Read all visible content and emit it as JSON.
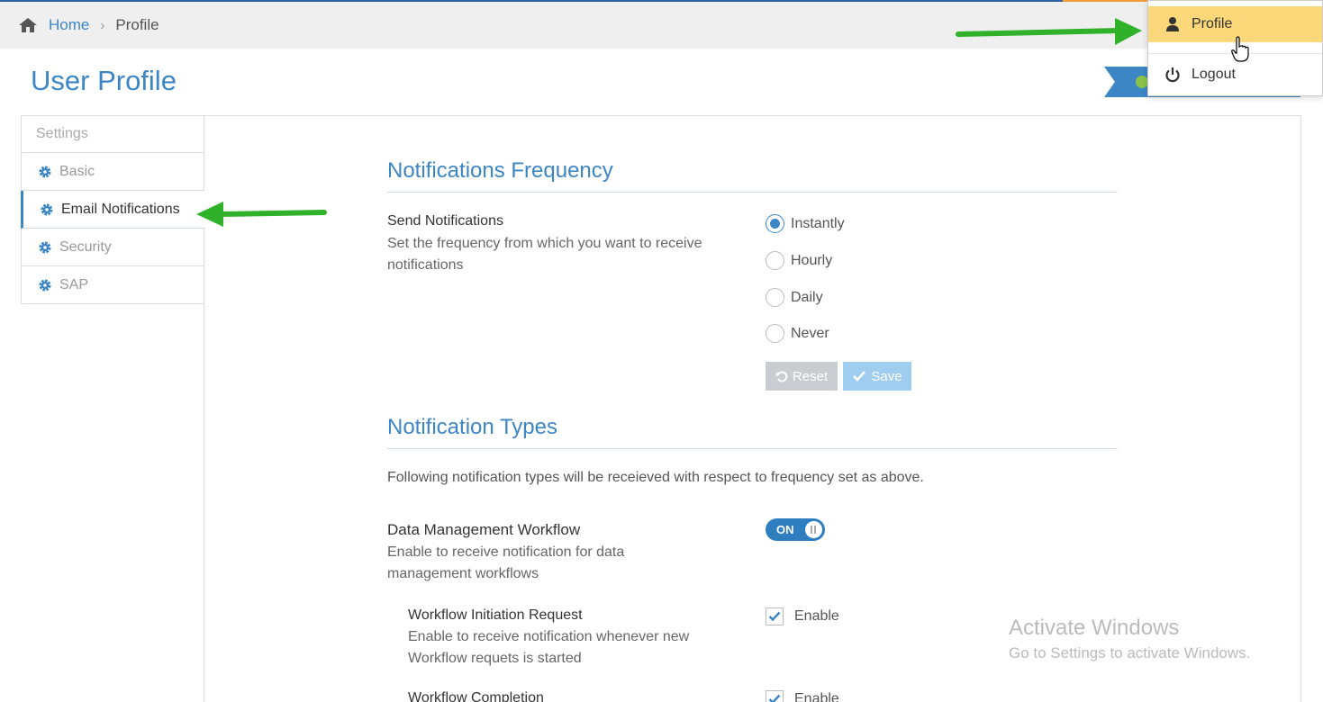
{
  "breadcrumb": {
    "home": "Home",
    "current": "Profile"
  },
  "page": {
    "title": "User Profile"
  },
  "sidebar": {
    "header": "Settings",
    "items": [
      {
        "label": "Basic"
      },
      {
        "label": "Email Notifications"
      },
      {
        "label": "Security"
      },
      {
        "label": "SAP"
      }
    ]
  },
  "frequency": {
    "section_title": "Notifications Frequency",
    "label": "Send Notifications",
    "description": "Set the frequency from which you want to receive notifications",
    "options": [
      "Instantly",
      "Hourly",
      "Daily",
      "Never"
    ],
    "selected": "Instantly",
    "reset_label": "Reset",
    "save_label": "Save"
  },
  "types": {
    "section_title": "Notification Types",
    "intro": "Following notification types will be receieved with respect to frequency set as above.",
    "workflow": {
      "label": "Data Management Workflow",
      "description": "Enable to receive notification for data management workflows",
      "toggle_label": "ON"
    },
    "initiation": {
      "label": "Workflow Initiation Request",
      "description": "Enable to receive notification whenever new Workflow requets is started",
      "checkbox_label": "Enable"
    },
    "completion": {
      "label": "Workflow Completion",
      "checkbox_label": "Enable"
    }
  },
  "user_menu": {
    "profile": "Profile",
    "logout": "Logout"
  },
  "watermark": {
    "title": "Activate Windows",
    "subtitle": "Go to Settings to activate Windows."
  },
  "colors": {
    "accent": "#3d86c6",
    "highlight": "#fcd87a",
    "annotation_arrow": "#2fb12a"
  }
}
